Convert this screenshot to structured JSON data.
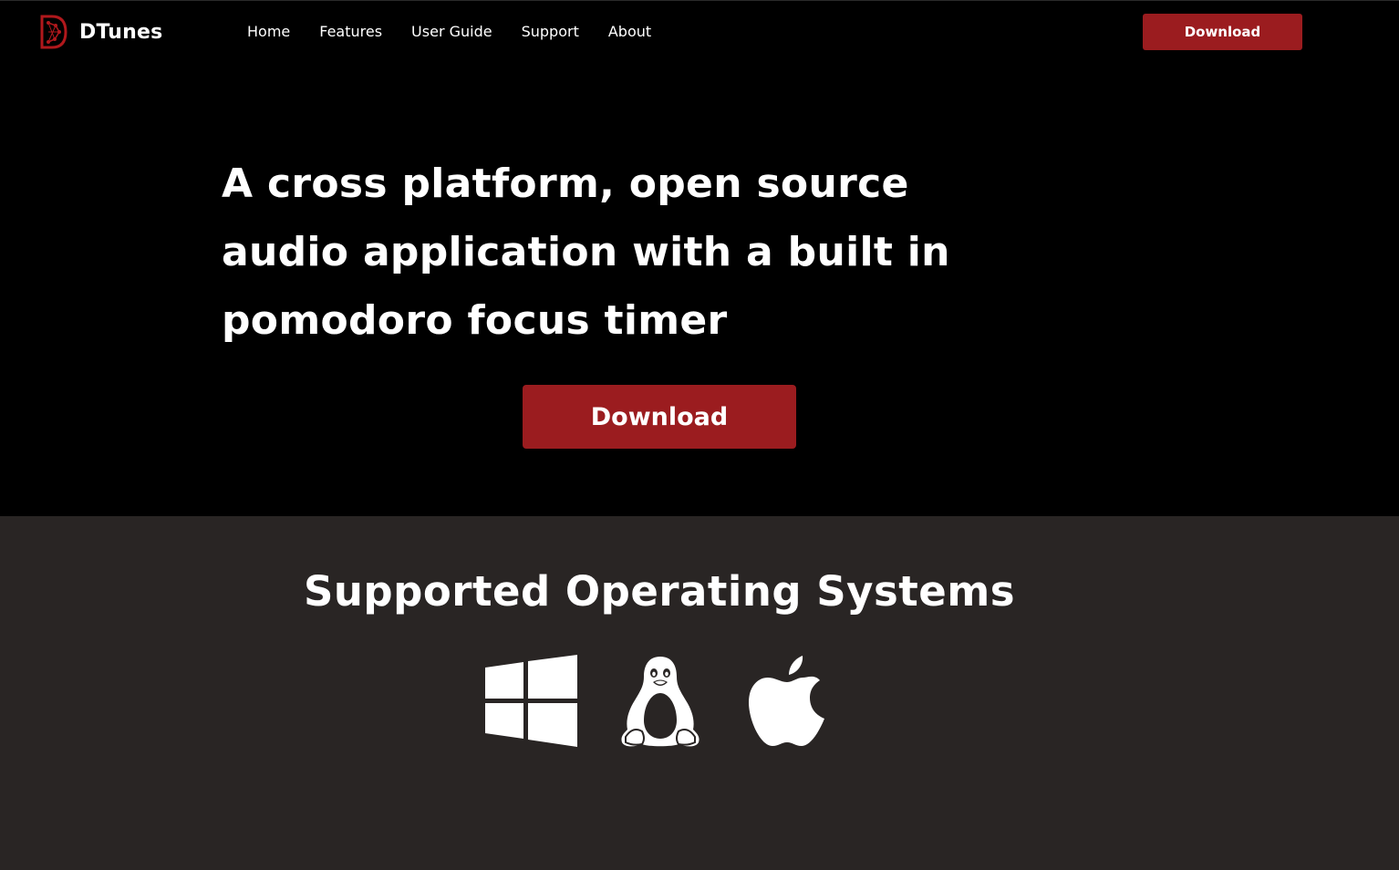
{
  "header": {
    "brand_name": "DTunes",
    "nav": [
      {
        "label": "Home"
      },
      {
        "label": "Features"
      },
      {
        "label": "User Guide"
      },
      {
        "label": "Support"
      },
      {
        "label": "About"
      }
    ],
    "download_label": "Download"
  },
  "hero": {
    "title": "A cross platform, open source audio application with a built in pomodoro focus timer",
    "download_label": "Download"
  },
  "os_section": {
    "title": "Supported Operating Systems",
    "icons": [
      "windows-logo-icon",
      "linux-tux-icon",
      "apple-logo-icon"
    ]
  },
  "colors": {
    "background": "#000000",
    "section_background": "#292524",
    "accent": "#9b1c1f",
    "text": "#ffffff"
  }
}
